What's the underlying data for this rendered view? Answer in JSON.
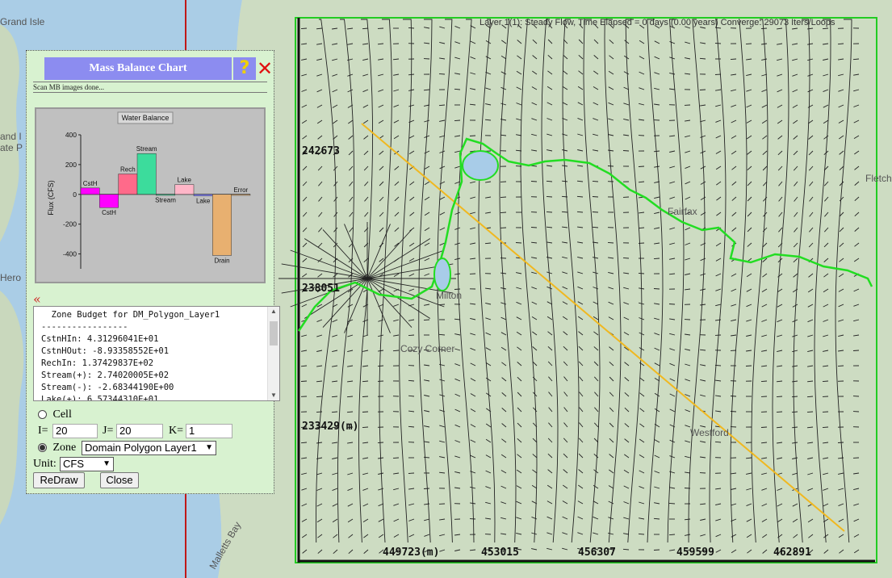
{
  "map": {
    "status_text": "Layer 1(1): Steady Flow, Time Elapsed = 0 days (0.00 years) Converge: 29073 Iters/Loops",
    "places": [
      "Grand Isle",
      "and I",
      "ate P",
      "Hero",
      "Fairfax",
      "Milton",
      "Cozy Corner",
      "Westford",
      "Fletch",
      "Malletts Bay"
    ],
    "y_coords": [
      "242673",
      "238051",
      "233429(m)"
    ],
    "x_coords": [
      "449723(m)",
      "453015",
      "456307",
      "459599",
      "462891"
    ],
    "colors": {
      "grid_border": "#22cc22",
      "river": "#22dd22",
      "section_line": "#f0b820",
      "water": "#a8cce8"
    }
  },
  "panel": {
    "title": "Mass Balance Chart",
    "help": "?",
    "close": "✕",
    "scan_msg": "Scan MB images done...",
    "collapse": "«",
    "budget_text": "  Zone Budget for DM_Polygon_Layer1\n-----------------\nCstnHIn: 4.31296041E+01\nCstnHOut: -8.93358552E+01\nRechIn: 1.37429837E+02\nStream(+): 2.74020005E+02\nStream(-): -2.68344190E+00\nLake(+): 6.57344310E+01",
    "cell_label": "Cell",
    "i_label": "I=",
    "i_value": "20",
    "j_label": "J=",
    "j_value": "20",
    "k_label": "K=",
    "k_value": "1",
    "zone_label": "Zone",
    "zone_value": "Domain Polygon Layer1",
    "unit_label": "Unit:",
    "unit_value": "CFS",
    "redraw": "ReDraw",
    "close_btn": "Close"
  },
  "chart_data": {
    "type": "bar",
    "title": "Water Balance",
    "ylabel": "Flux (CFS)",
    "ylim": [
      -500,
      400
    ],
    "yticks": [
      400,
      200,
      0,
      -200,
      -400
    ],
    "categories": [
      "CstH",
      "CstH",
      "Rech",
      "Stream",
      "Stream",
      "Lake",
      "Lake",
      "Drain",
      "Error"
    ],
    "values": [
      43,
      -89,
      137,
      274,
      -3,
      66,
      -10,
      -410,
      0
    ],
    "colors": [
      "#ff00ff",
      "#ff00ff",
      "#ff6a8a",
      "#3cdc9c",
      "#3cdc9c",
      "#ffb6c8",
      "#8080ff",
      "#e8b070",
      "#e8b070"
    ]
  }
}
